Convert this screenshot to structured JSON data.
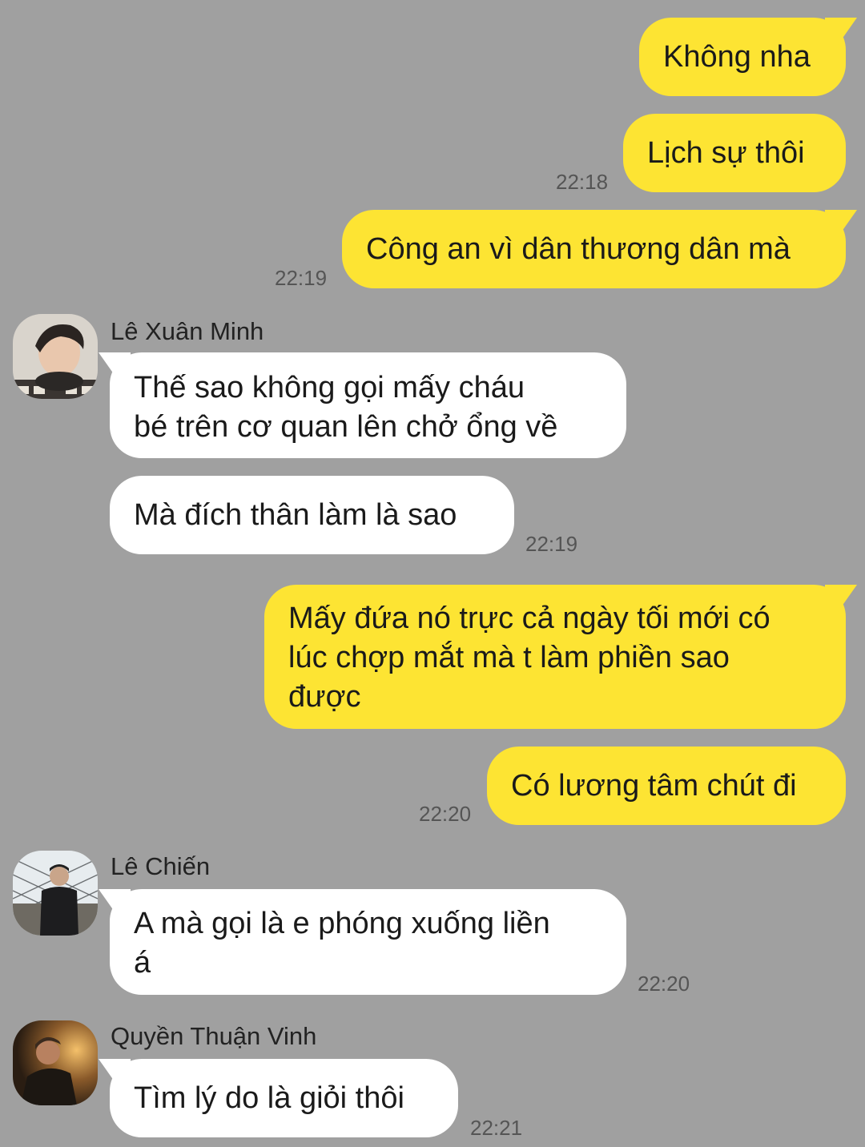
{
  "messages": {
    "m1": {
      "text": "Không nha"
    },
    "m2": {
      "text": "Lịch sự thôi",
      "time": "22:18"
    },
    "m3": {
      "text": "Công an vì dân thương dân mà",
      "time": "22:19"
    },
    "m4": {
      "sender": "Lê Xuân Minh",
      "text": "Thế sao không gọi mấy cháu\nbé trên cơ quan lên chở ổng về"
    },
    "m5": {
      "text": "Mà đích thân làm là sao",
      "time": "22:19"
    },
    "m6": {
      "text": "Mấy đứa nó trực cả ngày tối mới có\nlúc chợp mắt mà t làm phiền sao\nđược"
    },
    "m7": {
      "text": "Có lương tâm chút đi",
      "time": "22:20"
    },
    "m8": {
      "sender": "Lê Chiến",
      "text": "A mà gọi là e phóng xuống liền\ná",
      "time": "22:20"
    },
    "m9": {
      "sender": "Quyền Thuận Vinh",
      "text": "Tìm lý do là giỏi thôi",
      "time": "22:21"
    }
  },
  "colors": {
    "background": "#a0a0a0",
    "outgoing_bubble": "#fde433",
    "incoming_bubble": "#ffffff"
  },
  "icons": {
    "avatar_minh": "avatar-photo",
    "avatar_chien": "avatar-photo",
    "avatar_vinh": "avatar-photo"
  }
}
